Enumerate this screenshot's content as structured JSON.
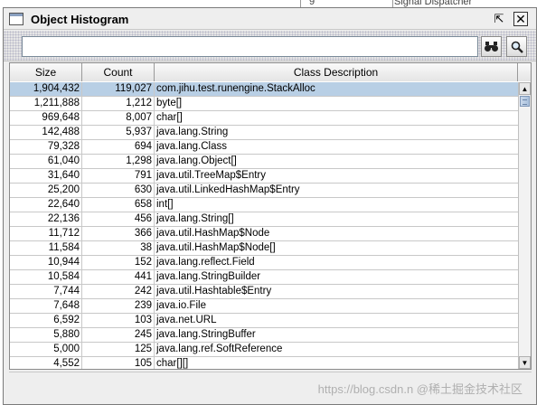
{
  "background": {
    "left_text": "9",
    "right_text": "Signal Dispatcher"
  },
  "window": {
    "title": "Object Histogram",
    "restore_glyph": "⇱",
    "close_glyph": "✕"
  },
  "toolbar": {
    "search_value": "",
    "search_placeholder": "",
    "find_icon": "binoculars-icon",
    "search_icon": "magnifier-icon",
    "find_glyph": "👓",
    "search_glyph": "🔍"
  },
  "table": {
    "columns": [
      "Size",
      "Count",
      "Class Description"
    ],
    "rows": [
      {
        "size": "1,904,432",
        "count": "119,027",
        "desc": "com.jihu.test.runengine.StackAlloc"
      },
      {
        "size": "1,211,888",
        "count": "1,212",
        "desc": "byte[]"
      },
      {
        "size": "969,648",
        "count": "8,007",
        "desc": "char[]"
      },
      {
        "size": "142,488",
        "count": "5,937",
        "desc": "java.lang.String"
      },
      {
        "size": "79,328",
        "count": "694",
        "desc": "java.lang.Class"
      },
      {
        "size": "61,040",
        "count": "1,298",
        "desc": "java.lang.Object[]"
      },
      {
        "size": "31,640",
        "count": "791",
        "desc": "java.util.TreeMap$Entry"
      },
      {
        "size": "25,200",
        "count": "630",
        "desc": "java.util.LinkedHashMap$Entry"
      },
      {
        "size": "22,640",
        "count": "658",
        "desc": "int[]"
      },
      {
        "size": "22,136",
        "count": "456",
        "desc": "java.lang.String[]"
      },
      {
        "size": "11,712",
        "count": "366",
        "desc": "java.util.HashMap$Node"
      },
      {
        "size": "11,584",
        "count": "38",
        "desc": "java.util.HashMap$Node[]"
      },
      {
        "size": "10,944",
        "count": "152",
        "desc": "java.lang.reflect.Field"
      },
      {
        "size": "10,584",
        "count": "441",
        "desc": "java.lang.StringBuilder"
      },
      {
        "size": "7,744",
        "count": "242",
        "desc": "java.util.Hashtable$Entry"
      },
      {
        "size": "7,648",
        "count": "239",
        "desc": "java.io.File"
      },
      {
        "size": "6,592",
        "count": "103",
        "desc": "java.net.URL"
      },
      {
        "size": "5,880",
        "count": "245",
        "desc": "java.lang.StringBuffer"
      },
      {
        "size": "5,000",
        "count": "125",
        "desc": "java.lang.ref.SoftReference"
      },
      {
        "size": "4,552",
        "count": "105",
        "desc": "char[][]"
      }
    ],
    "selected_row": 0
  },
  "scrollbar": {
    "up_glyph": "▲",
    "down_glyph": "▼"
  },
  "status": {
    "watermark": "https://blog.csdn.n @稀土掘金技术社区"
  }
}
